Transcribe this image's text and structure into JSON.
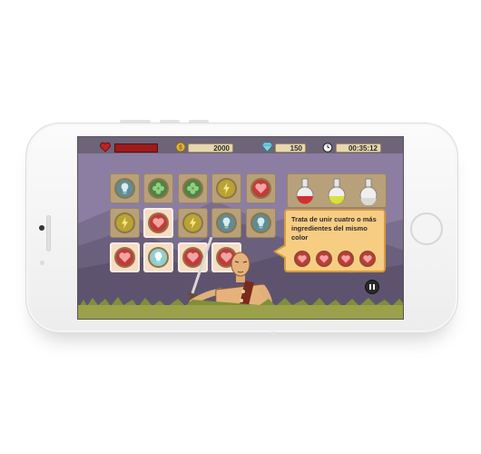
{
  "hud": {
    "coins": "2000",
    "gems": "150",
    "timer": "00:35:12",
    "icons": [
      "heart-icon",
      "coin-icon",
      "gem-icon",
      "clock-icon"
    ]
  },
  "board": {
    "rows": [
      [
        "blue-bulb",
        "green-clover",
        "green-clover",
        "yellow-bolt",
        "red-heart"
      ],
      [
        "yellow-bolt",
        "red-heart",
        "yellow-bolt",
        "blue-bulb",
        "blue-bulb"
      ],
      [
        "red-heart",
        "cyan-bulb",
        "red-heart",
        "red-heart",
        "hidden"
      ]
    ]
  },
  "potions": [
    "red-potion",
    "yellow-potion",
    "empty-potion"
  ],
  "tip": {
    "text": "Trata de unir cuatro o más ingredientes del mismo color",
    "tokens": [
      "red-heart",
      "red-heart",
      "red-heart",
      "red-heart"
    ]
  },
  "colors": {
    "sky": "#8c7ea3",
    "hud_bar": "#6d6478",
    "tile": "#b8a07a",
    "highlight_tile": "#f8dcc4",
    "bubble": "#f7cd84",
    "red_token": "#c23b3b"
  }
}
